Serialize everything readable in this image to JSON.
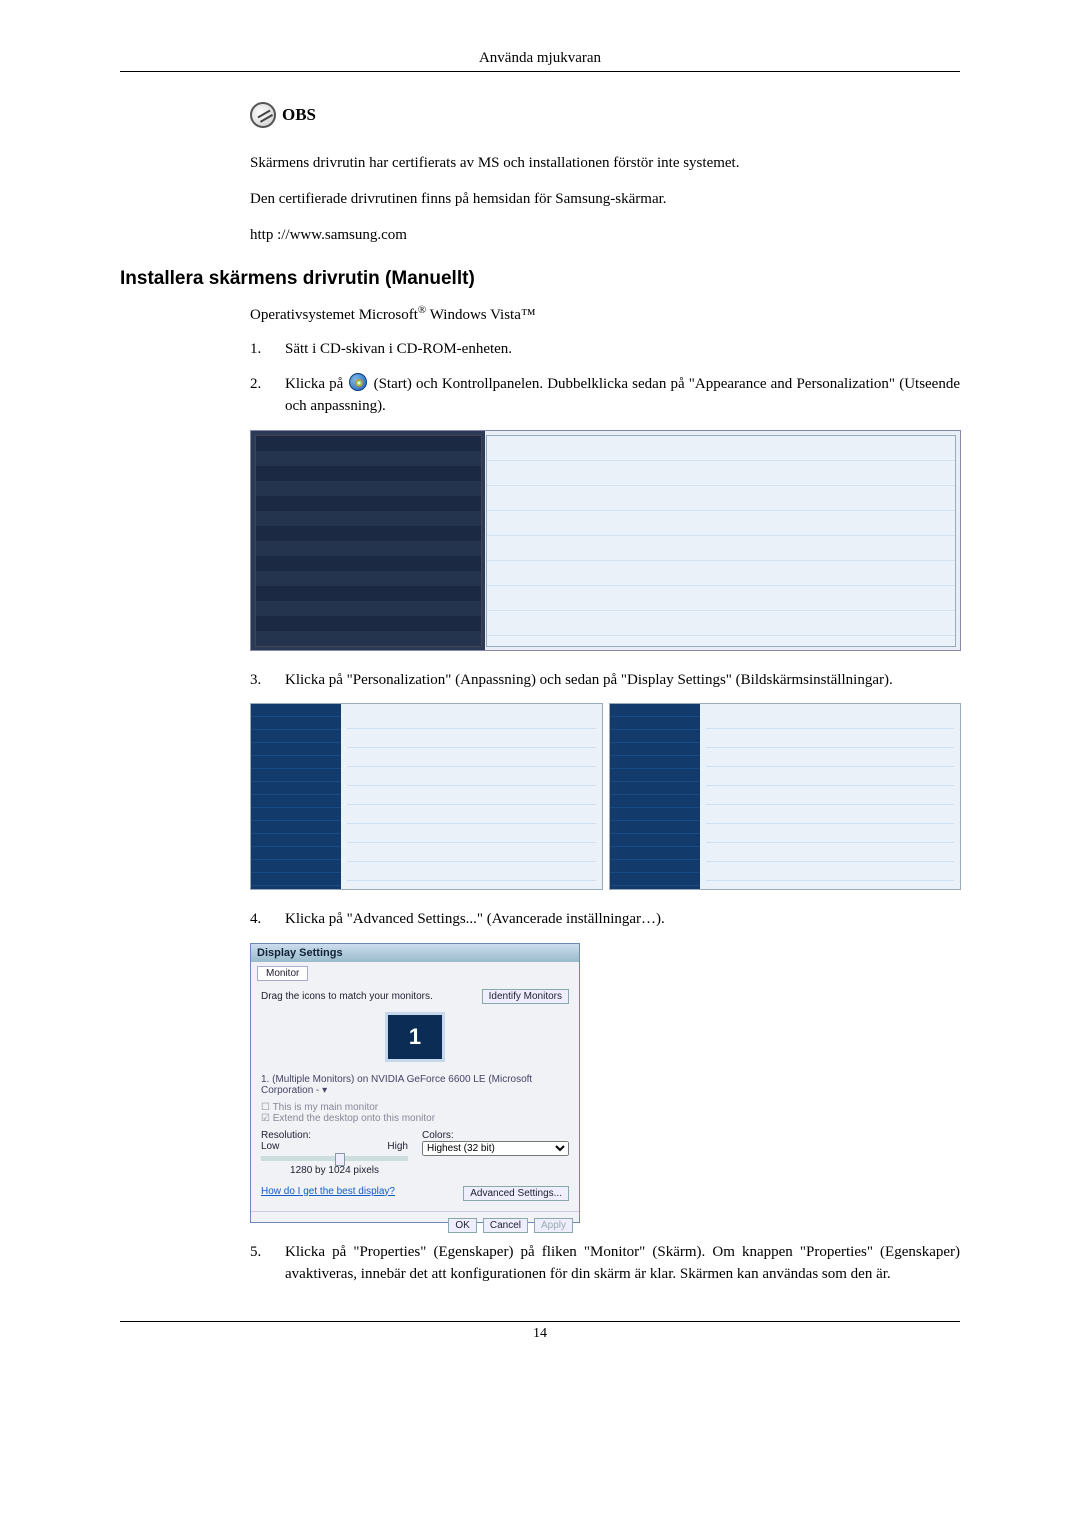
{
  "header": "Använda mjukvaran",
  "obs": {
    "label": "OBS",
    "p1": "Skärmens drivrutin har certifierats av MS och installationen förstör inte systemet.",
    "p2": "Den certifierade drivrutinen finns på hemsidan för Samsung-skärmar.",
    "p3": "http ://www.samsung.com"
  },
  "h2": "Installera skärmens drivrutin (Manuellt)",
  "os_prefix": "Operativsystemet Microsoft",
  "os_suffix": " Windows Vista™",
  "steps": {
    "s1": {
      "num": "1.",
      "text": "Sätt i CD-skivan i CD-ROM-enheten."
    },
    "s2": {
      "num": "2.",
      "pre": "Klicka på ",
      "post": " (Start) och Kontrollpanelen. Dubbelklicka sedan på \"Appearance and Personalization\" (Utseende och anpassning)."
    },
    "s3": {
      "num": "3.",
      "text": "Klicka på \"Personalization\" (Anpassning) och sedan på \"Display Settings\" (Bildskärmsinställningar)."
    },
    "s4": {
      "num": "4.",
      "text": "Klicka på \"Advanced Settings...\" (Avancerade inställningar…)."
    },
    "s5": {
      "num": "5.",
      "text": "Klicka på \"Properties\" (Egenskaper) på fliken \"Monitor\" (Skärm). Om knappen \"Properties\" (Egenskaper) avaktiveras, innebär det att konfigurationen för din skärm är klar. Skärmen kan användas som den är."
    }
  },
  "display_dialog": {
    "title": "Display Settings",
    "tab": "Monitor",
    "drag_text": "Drag the icons to match your monitors.",
    "identify": "Identify Monitors",
    "monitor_num": "1",
    "desc": "1. (Multiple Monitors) on NVIDIA GeForce 6600 LE (Microsoft Corporation - ▾",
    "cb1": "☐ This is my main monitor",
    "cb2": "☑ Extend the desktop onto this monitor",
    "res_label": "Resolution:",
    "low": "Low",
    "high": "High",
    "res_value": "1280 by 1024 pixels",
    "colors_label": "Colors:",
    "colors_value": "Highest (32 bit)",
    "help_link": "How do I get the best display?",
    "advanced": "Advanced Settings...",
    "ok": "OK",
    "cancel": "Cancel",
    "apply": "Apply"
  },
  "page_num": "14"
}
